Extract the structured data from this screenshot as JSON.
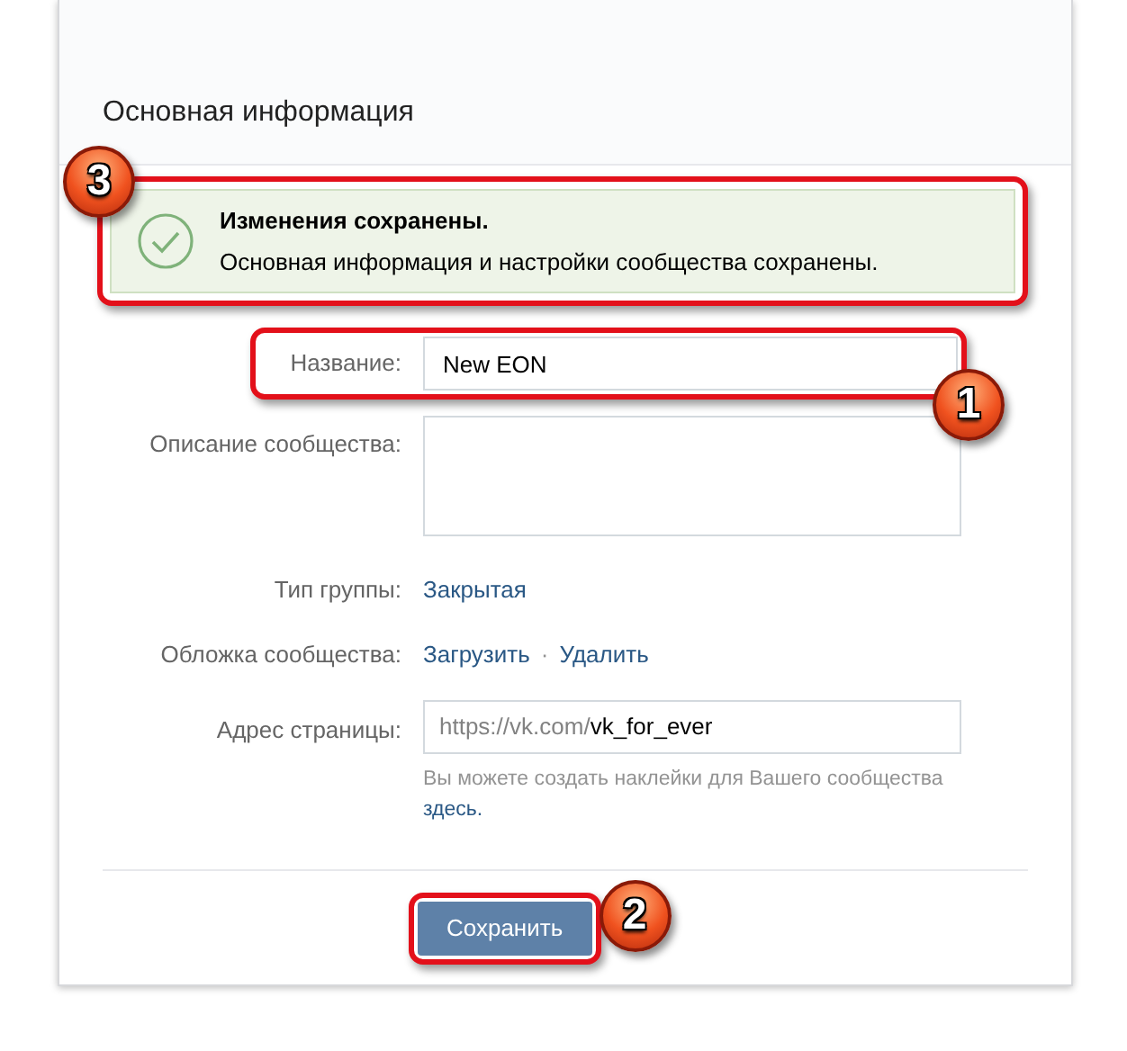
{
  "section": {
    "title": "Основная информация"
  },
  "notice": {
    "title": "Изменения сохранены.",
    "text": "Основная информация и настройки сообщества сохранены.",
    "highlighted": true,
    "badge": "3"
  },
  "rows": [
    {
      "kind": "input",
      "label": "Название:",
      "value": "New EON",
      "highlighted": true,
      "badge": "1"
    },
    {
      "kind": "textarea",
      "label": "Описание сообщества:"
    },
    {
      "kind": "text",
      "label": "Тип группы:",
      "value": "Закрытая"
    },
    {
      "kind": "links",
      "label": "Обложка сообщества:",
      "links": [
        "Загрузить",
        "Удалить"
      ],
      "separator": "·"
    },
    {
      "kind": "address",
      "label": "Адрес страницы:",
      "prefix": "https://vk.com/",
      "value": "vk_for_ever",
      "hint": "Вы можете создать наклейки для Вашего сообщества",
      "hint_link": "здесь."
    }
  ],
  "save_button": {
    "label": "Сохранить",
    "highlighted": true,
    "badge": "2"
  }
}
